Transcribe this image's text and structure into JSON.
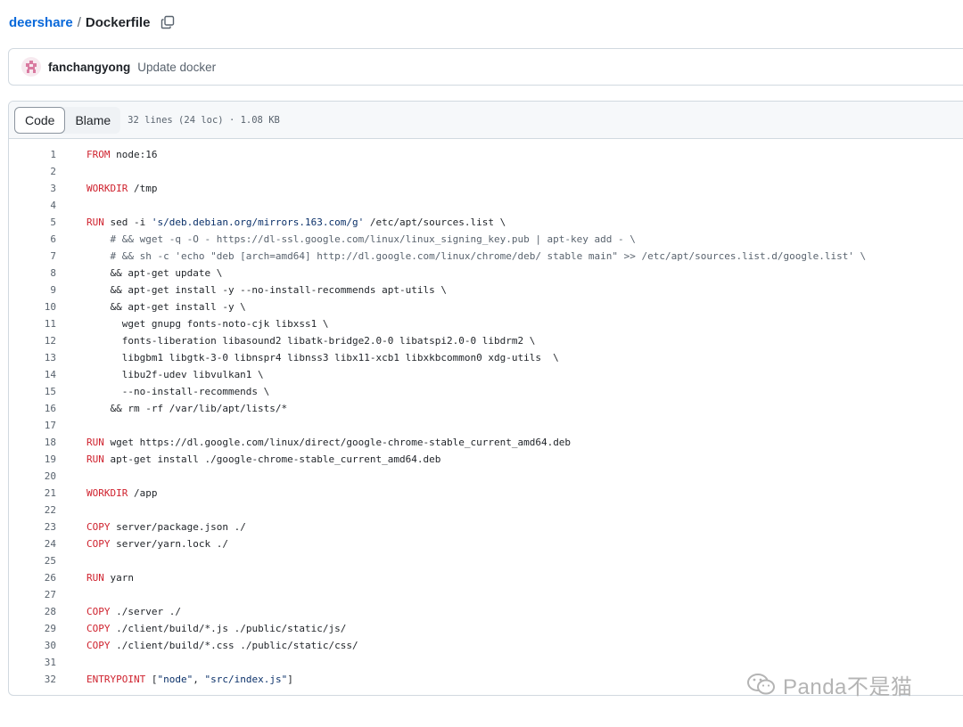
{
  "breadcrumb": {
    "repo": "deershare",
    "separator": "/",
    "file": "Dockerfile"
  },
  "commit": {
    "author": "fanchangyong",
    "message": "Update docker"
  },
  "file_header": {
    "tabs": [
      {
        "label": "Code",
        "active": true
      },
      {
        "label": "Blame",
        "active": false
      }
    ],
    "meta": "32 lines (24 loc) · 1.08 KB"
  },
  "code_lines": [
    {
      "n": "1",
      "kw": "FROM",
      "rest": " node:16"
    },
    {
      "n": "2",
      "kw": "",
      "rest": ""
    },
    {
      "n": "3",
      "kw": "WORKDIR",
      "rest": " /tmp"
    },
    {
      "n": "4",
      "kw": "",
      "rest": ""
    },
    {
      "n": "5",
      "kw": "RUN",
      "rest": " sed -i ",
      "str": "'s/deb.debian.org/mirrors.163.com/g'",
      "rest2": " /etc/apt/sources.list \\"
    },
    {
      "n": "6",
      "kw": "",
      "rest": "",
      "cmt": "    # && wget -q -O - https://dl-ssl.google.com/linux/linux_signing_key.pub | apt-key add - \\"
    },
    {
      "n": "7",
      "kw": "",
      "rest": "",
      "cmt": "    # && sh -c 'echo \"deb [arch=amd64] http://dl.google.com/linux/chrome/deb/ stable main\" >> /etc/apt/sources.list.d/google.list' \\"
    },
    {
      "n": "8",
      "kw": "",
      "rest": "    && apt-get update \\"
    },
    {
      "n": "9",
      "kw": "",
      "rest": "    && apt-get install -y --no-install-recommends apt-utils \\"
    },
    {
      "n": "10",
      "kw": "",
      "rest": "    && apt-get install -y \\"
    },
    {
      "n": "11",
      "kw": "",
      "rest": "      wget gnupg fonts-noto-cjk libxss1 \\"
    },
    {
      "n": "12",
      "kw": "",
      "rest": "      fonts-liberation libasound2 libatk-bridge2.0-0 libatspi2.0-0 libdrm2 \\"
    },
    {
      "n": "13",
      "kw": "",
      "rest": "      libgbm1 libgtk-3-0 libnspr4 libnss3 libx11-xcb1 libxkbcommon0 xdg-utils  \\"
    },
    {
      "n": "14",
      "kw": "",
      "rest": "      libu2f-udev libvulkan1 \\"
    },
    {
      "n": "15",
      "kw": "",
      "rest": "      --no-install-recommends \\"
    },
    {
      "n": "16",
      "kw": "",
      "rest": "    && rm -rf /var/lib/apt/lists/*"
    },
    {
      "n": "17",
      "kw": "",
      "rest": ""
    },
    {
      "n": "18",
      "kw": "RUN",
      "rest": " wget https://dl.google.com/linux/direct/google-chrome-stable_current_amd64.deb"
    },
    {
      "n": "19",
      "kw": "RUN",
      "rest": " apt-get install ./google-chrome-stable_current_amd64.deb"
    },
    {
      "n": "20",
      "kw": "",
      "rest": ""
    },
    {
      "n": "21",
      "kw": "WORKDIR",
      "rest": " /app"
    },
    {
      "n": "22",
      "kw": "",
      "rest": ""
    },
    {
      "n": "23",
      "kw": "COPY",
      "rest": " server/package.json ./"
    },
    {
      "n": "24",
      "kw": "COPY",
      "rest": " server/yarn.lock ./"
    },
    {
      "n": "25",
      "kw": "",
      "rest": ""
    },
    {
      "n": "26",
      "kw": "RUN",
      "rest": " yarn"
    },
    {
      "n": "27",
      "kw": "",
      "rest": ""
    },
    {
      "n": "28",
      "kw": "COPY",
      "rest": " ./server ./"
    },
    {
      "n": "29",
      "kw": "COPY",
      "rest": " ./client/build/*.js ./public/static/js/"
    },
    {
      "n": "30",
      "kw": "COPY",
      "rest": " ./client/build/*.css ./public/static/css/"
    },
    {
      "n": "31",
      "kw": "",
      "rest": ""
    },
    {
      "n": "32",
      "kw": "ENTRYPOINT",
      "rest": " [",
      "str": "\"node\"",
      "rest2": ", ",
      "str2": "\"src/index.js\"",
      "rest3": "]"
    }
  ],
  "watermark": {
    "text": "Panda不是猫"
  },
  "icons": {
    "copy": "copy-icon",
    "avatar": "avatar-icon",
    "watermark_logo": "wechat-icon"
  },
  "colors": {
    "link": "#0969da",
    "keyword": "#cf222e",
    "string": "#0a3069",
    "comment": "#59636e"
  }
}
